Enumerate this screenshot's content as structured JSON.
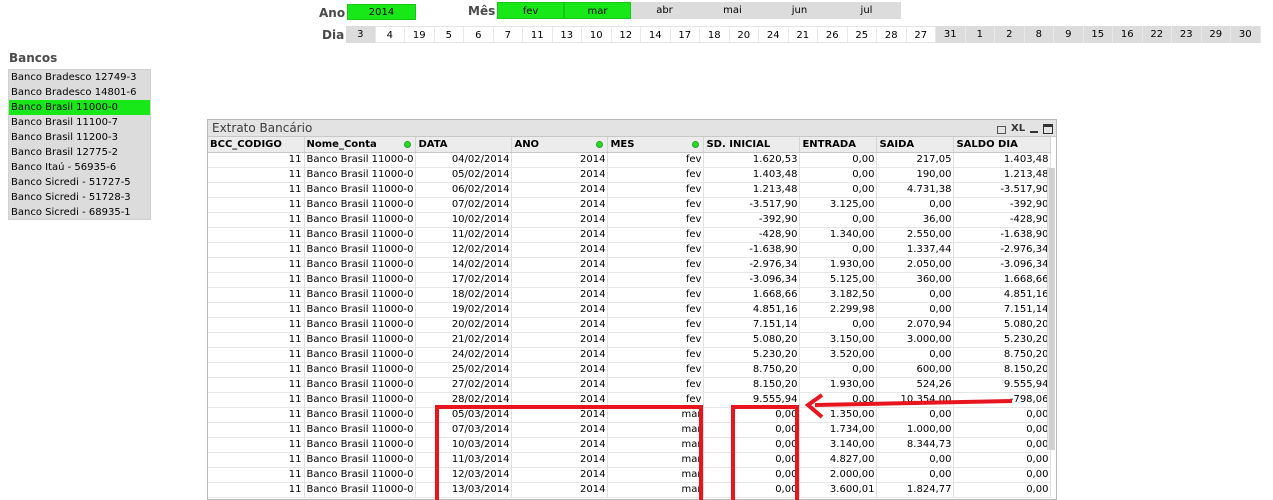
{
  "filters": {
    "ano": {
      "label": "Ano",
      "value": "2014"
    },
    "mes": {
      "label": "Mês",
      "items": [
        {
          "text": "fev",
          "state": "selected"
        },
        {
          "text": "mar",
          "state": "selected"
        },
        {
          "text": "abr",
          "state": "alternative"
        },
        {
          "text": "mai",
          "state": "alternative"
        },
        {
          "text": "jun",
          "state": "alternative"
        },
        {
          "text": "jul",
          "state": "alternative"
        }
      ]
    },
    "dia": {
      "label": "Dia",
      "items": [
        {
          "text": "3",
          "state": "alternative"
        },
        {
          "text": "4",
          "state": "possible"
        },
        {
          "text": "19",
          "state": "possible"
        },
        {
          "text": "5",
          "state": "possible"
        },
        {
          "text": "6",
          "state": "possible"
        },
        {
          "text": "7",
          "state": "possible"
        },
        {
          "text": "11",
          "state": "possible"
        },
        {
          "text": "13",
          "state": "possible"
        },
        {
          "text": "10",
          "state": "possible"
        },
        {
          "text": "12",
          "state": "possible"
        },
        {
          "text": "14",
          "state": "possible"
        },
        {
          "text": "17",
          "state": "possible"
        },
        {
          "text": "18",
          "state": "possible"
        },
        {
          "text": "20",
          "state": "possible"
        },
        {
          "text": "24",
          "state": "possible"
        },
        {
          "text": "21",
          "state": "possible"
        },
        {
          "text": "26",
          "state": "possible"
        },
        {
          "text": "25",
          "state": "possible"
        },
        {
          "text": "28",
          "state": "possible"
        },
        {
          "text": "27",
          "state": "possible"
        },
        {
          "text": "31",
          "state": "alternative"
        },
        {
          "text": "1",
          "state": "alternative"
        },
        {
          "text": "2",
          "state": "alternative"
        },
        {
          "text": "8",
          "state": "alternative"
        },
        {
          "text": "9",
          "state": "alternative"
        },
        {
          "text": "15",
          "state": "alternative"
        },
        {
          "text": "16",
          "state": "alternative"
        },
        {
          "text": "22",
          "state": "alternative"
        },
        {
          "text": "23",
          "state": "alternative"
        },
        {
          "text": "29",
          "state": "alternative"
        },
        {
          "text": "30",
          "state": "alternative"
        }
      ]
    }
  },
  "bancos": {
    "title": "Bancos",
    "selected_index": 2,
    "items": [
      "Banco Bradesco 12749-3",
      "Banco Bradesco 14801-6",
      "Banco Brasil 11000-0",
      "Banco Brasil 11100-7",
      "Banco Brasil 11200-3",
      "Banco Brasil 12775-2",
      "Banco Itaú - 56935-6",
      "Banco Sicredi - 51727-5",
      "Banco Sicredi - 51728-3",
      "Banco Sicredi - 68935-1"
    ]
  },
  "extrato": {
    "title": "Extrato Bancário",
    "xl_label": "XL",
    "columns": [
      "BCC_CODIGO",
      "Nome_Conta",
      "DATA",
      "ANO",
      "MES",
      "SD. INICIAL",
      "ENTRADA",
      "SAIDA",
      "SALDO DIA"
    ],
    "rows": [
      [
        "11",
        "Banco Brasil 11000-0",
        "04/02/2014",
        "2014",
        "fev",
        "1.620,53",
        "0,00",
        "217,05",
        "1.403,48"
      ],
      [
        "11",
        "Banco Brasil 11000-0",
        "05/02/2014",
        "2014",
        "fev",
        "1.403,48",
        "0,00",
        "190,00",
        "1.213,48"
      ],
      [
        "11",
        "Banco Brasil 11000-0",
        "06/02/2014",
        "2014",
        "fev",
        "1.213,48",
        "0,00",
        "4.731,38",
        "-3.517,90"
      ],
      [
        "11",
        "Banco Brasil 11000-0",
        "07/02/2014",
        "2014",
        "fev",
        "-3.517,90",
        "3.125,00",
        "0,00",
        "-392,90"
      ],
      [
        "11",
        "Banco Brasil 11000-0",
        "10/02/2014",
        "2014",
        "fev",
        "-392,90",
        "0,00",
        "36,00",
        "-428,90"
      ],
      [
        "11",
        "Banco Brasil 11000-0",
        "11/02/2014",
        "2014",
        "fev",
        "-428,90",
        "1.340,00",
        "2.550,00",
        "-1.638,90"
      ],
      [
        "11",
        "Banco Brasil 11000-0",
        "12/02/2014",
        "2014",
        "fev",
        "-1.638,90",
        "0,00",
        "1.337,44",
        "-2.976,34"
      ],
      [
        "11",
        "Banco Brasil 11000-0",
        "14/02/2014",
        "2014",
        "fev",
        "-2.976,34",
        "1.930,00",
        "2.050,00",
        "-3.096,34"
      ],
      [
        "11",
        "Banco Brasil 11000-0",
        "17/02/2014",
        "2014",
        "fev",
        "-3.096,34",
        "5.125,00",
        "360,00",
        "1.668,66"
      ],
      [
        "11",
        "Banco Brasil 11000-0",
        "18/02/2014",
        "2014",
        "fev",
        "1.668,66",
        "3.182,50",
        "0,00",
        "4.851,16"
      ],
      [
        "11",
        "Banco Brasil 11000-0",
        "19/02/2014",
        "2014",
        "fev",
        "4.851,16",
        "2.299,98",
        "0,00",
        "7.151,14"
      ],
      [
        "11",
        "Banco Brasil 11000-0",
        "20/02/2014",
        "2014",
        "fev",
        "7.151,14",
        "0,00",
        "2.070,94",
        "5.080,20"
      ],
      [
        "11",
        "Banco Brasil 11000-0",
        "21/02/2014",
        "2014",
        "fev",
        "5.080,20",
        "3.150,00",
        "3.000,00",
        "5.230,20"
      ],
      [
        "11",
        "Banco Brasil 11000-0",
        "24/02/2014",
        "2014",
        "fev",
        "5.230,20",
        "3.520,00",
        "0,00",
        "8.750,20"
      ],
      [
        "11",
        "Banco Brasil 11000-0",
        "25/02/2014",
        "2014",
        "fev",
        "8.750,20",
        "0,00",
        "600,00",
        "8.150,20"
      ],
      [
        "11",
        "Banco Brasil 11000-0",
        "27/02/2014",
        "2014",
        "fev",
        "8.150,20",
        "1.930,00",
        "524,26",
        "9.555,94"
      ],
      [
        "11",
        "Banco Brasil 11000-0",
        "28/02/2014",
        "2014",
        "fev",
        "9.555,94",
        "0,00",
        "10.354,00",
        "-798,06"
      ],
      [
        "11",
        "Banco Brasil 11000-0",
        "05/03/2014",
        "2014",
        "mar",
        "0,00",
        "1.350,00",
        "0,00",
        "0,00"
      ],
      [
        "11",
        "Banco Brasil 11000-0",
        "07/03/2014",
        "2014",
        "mar",
        "0,00",
        "1.734,00",
        "1.000,00",
        "0,00"
      ],
      [
        "11",
        "Banco Brasil 11000-0",
        "10/03/2014",
        "2014",
        "mar",
        "0,00",
        "3.140,00",
        "8.344,73",
        "0,00"
      ],
      [
        "11",
        "Banco Brasil 11000-0",
        "11/03/2014",
        "2014",
        "mar",
        "0,00",
        "4.827,00",
        "0,00",
        "0,00"
      ],
      [
        "11",
        "Banco Brasil 11000-0",
        "12/03/2014",
        "2014",
        "mar",
        "0,00",
        "2.000,00",
        "0,00",
        "0,00"
      ],
      [
        "11",
        "Banco Brasil 11000-0",
        "13/03/2014",
        "2014",
        "mar",
        "0,00",
        "3.600,01",
        "1.824,77",
        "0,00"
      ]
    ]
  },
  "colors": {
    "selected": "#18e818",
    "alternative": "#dcdcdc",
    "annotation_red": "#e8141e"
  }
}
